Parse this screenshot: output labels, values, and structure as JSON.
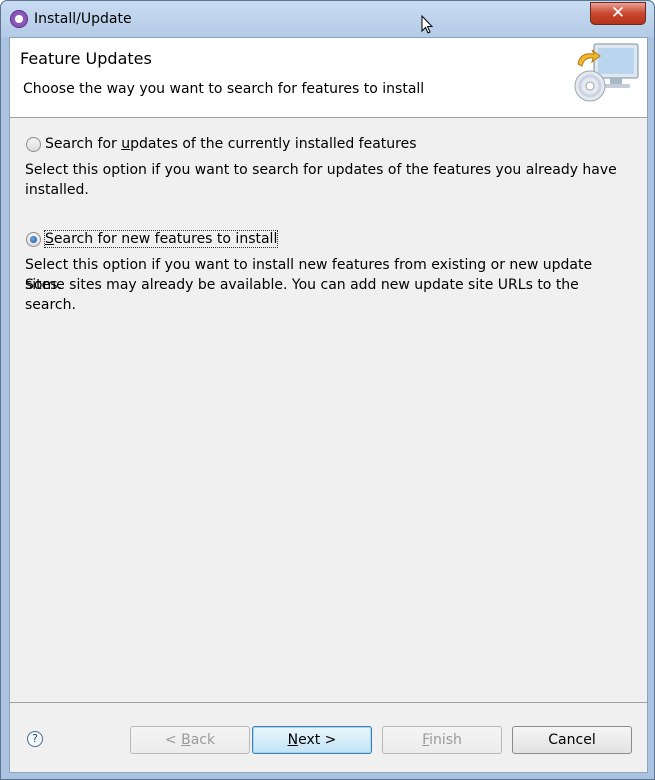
{
  "window": {
    "title": "Install/Update",
    "close_glyph": "✕"
  },
  "header": {
    "title": "Feature Updates",
    "description": "Choose the way you want to search for features to install",
    "icon": "install-wizard-icon"
  },
  "options": [
    {
      "label_pre": "Search for ",
      "label_mnemonic": "u",
      "label_post": "pdates of the currently installed features",
      "checked": false,
      "description": "Select this option if you want to search for updates of the features you already have installed."
    },
    {
      "label_pre": "",
      "label_mnemonic": "S",
      "label_post": "earch for new features to install",
      "checked": true,
      "description_line1": "Select this option if you want to install new features from existing or new update sites.",
      "description_line2": "Some sites may already be available. You can add new update site URLs to the search."
    }
  ],
  "footer": {
    "help_glyph": "?",
    "back": {
      "pre": "< ",
      "mnemonic": "B",
      "post": "ack",
      "enabled": false
    },
    "next": {
      "mnemonic": "N",
      "post": "ext >",
      "enabled": true
    },
    "finish": {
      "mnemonic": "F",
      "post": "inish",
      "enabled": false
    },
    "cancel": {
      "label": "Cancel",
      "enabled": true
    }
  }
}
